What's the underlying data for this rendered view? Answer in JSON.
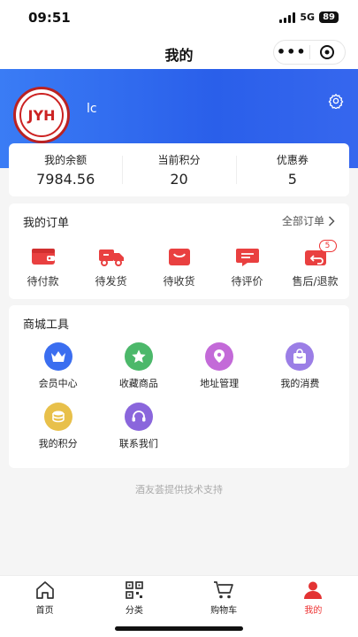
{
  "status_bar": {
    "time": "09:51",
    "network": "5G",
    "battery": "89"
  },
  "nav": {
    "title": "我的",
    "menu_icon": "more-dots-icon",
    "target_icon": "target-icon"
  },
  "profile": {
    "avatar_text": "JYH",
    "username": "lc"
  },
  "colors": {
    "brand_blue": "#2a5fea",
    "accent_red": "#e33333",
    "primary_text": "#222222"
  },
  "stats": [
    {
      "label": "我的余额",
      "value": "7984.56"
    },
    {
      "label": "当前积分",
      "value": "20"
    },
    {
      "label": "优惠券",
      "value": "5"
    }
  ],
  "orders": {
    "title": "我的订单",
    "all_label": "全部订单",
    "items": [
      {
        "label": "待付款",
        "icon": "wallet-icon"
      },
      {
        "label": "待发货",
        "icon": "truck-icon"
      },
      {
        "label": "待收货",
        "icon": "package-icon"
      },
      {
        "label": "待评价",
        "icon": "comment-icon"
      },
      {
        "label": "售后/退款",
        "icon": "refund-icon",
        "badge": "5"
      }
    ]
  },
  "tools": {
    "title": "商城工具",
    "items": [
      {
        "label": "会员中心",
        "icon": "crown-icon",
        "color": "#3b6ef0"
      },
      {
        "label": "收藏商品",
        "icon": "star-icon",
        "color": "#4cb86a"
      },
      {
        "label": "地址管理",
        "icon": "location-icon",
        "color": "#c36ad8"
      },
      {
        "label": "我的消费",
        "icon": "bag-icon",
        "color": "#9b7ee6"
      },
      {
        "label": "我的积分",
        "icon": "coins-icon",
        "color": "#e8c04a"
      },
      {
        "label": "联系我们",
        "icon": "headset-icon",
        "color": "#8a66dc"
      }
    ]
  },
  "footer_text": "酒友荟提供技术支持",
  "tab_bar": [
    {
      "label": "首页",
      "icon": "home-icon"
    },
    {
      "label": "分类",
      "icon": "qr-grid-icon"
    },
    {
      "label": "购物车",
      "icon": "cart-icon"
    },
    {
      "label": "我的",
      "icon": "user-icon",
      "active": true
    }
  ]
}
